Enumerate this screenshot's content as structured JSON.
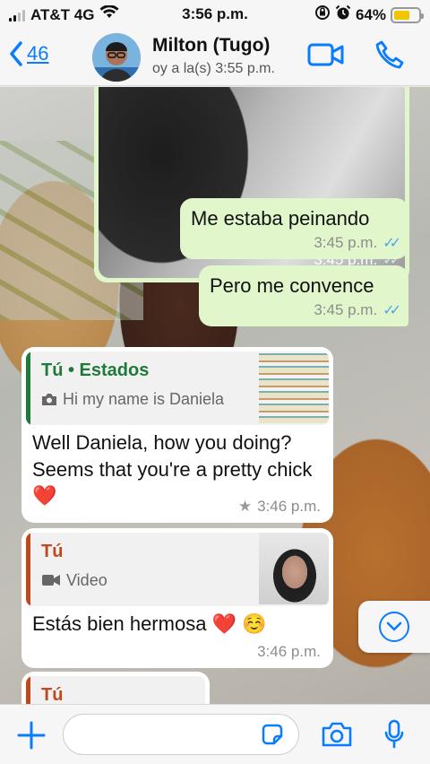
{
  "status_bar": {
    "carrier": "AT&T 4G",
    "time": "3:56 p.m.",
    "battery": "64%",
    "battery_level": 0.64
  },
  "header": {
    "back_count": "46",
    "contact_name": "Milton (Tugo)",
    "last_seen": "oy a la(s) 3:55 p.m.",
    "icons": [
      "chevron-left-icon",
      "video-call-icon",
      "phone-icon"
    ]
  },
  "messages": [
    {
      "type": "image",
      "direction": "outgoing",
      "time": "3:45 p.m.",
      "status": "read"
    },
    {
      "type": "text",
      "direction": "outgoing",
      "text": "Me estaba peinando",
      "time": "3:45 p.m.",
      "status": "read"
    },
    {
      "type": "text",
      "direction": "outgoing",
      "text": "Pero me convence",
      "time": "3:45 p.m.",
      "status": "read"
    },
    {
      "type": "reply",
      "direction": "incoming",
      "quote": {
        "author": "Tú • Estados",
        "subtitle": "Hi my name is Daniela",
        "icon": "camera-icon",
        "accent": "#1f7a3a"
      },
      "text": "Well Daniela, how you doing? Seems that you're a pretty chick ❤️",
      "time": "3:46 p.m.",
      "starred": true
    },
    {
      "type": "reply",
      "direction": "incoming",
      "quote": {
        "author": "Tú",
        "subtitle": "Video",
        "icon": "video-icon",
        "accent": "#c0481c"
      },
      "text": "Estás bien hermosa ❤️ ☺️",
      "time": "3:46 p.m."
    },
    {
      "type": "reply",
      "direction": "incoming",
      "quote": {
        "author": "Tú",
        "accent": "#c0481c"
      }
    }
  ],
  "input_bar": {
    "placeholder": "",
    "icons": [
      "plus-icon",
      "sticker-icon",
      "camera-icon",
      "microphone-icon"
    ]
  },
  "colors": {
    "accent": "#0a7cff",
    "outgoing_bubble": "#e1f7cb",
    "incoming_bubble": "#ffffff",
    "read_ticks": "#4aa7e8"
  }
}
